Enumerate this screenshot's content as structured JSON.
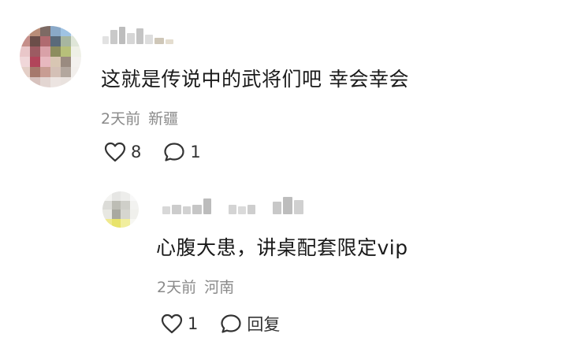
{
  "comments": [
    {
      "text": "这就是传说中的武将们吧 幸会幸会",
      "time": "2天前",
      "location": "新疆",
      "like_count": "8",
      "reply_count": "1",
      "avatar_pixels": [
        "#d9b9ae",
        "#b98d78",
        "#7d6a64",
        "#8aa9c8",
        "#9fc3e3",
        "#e6eef5",
        "#c58f8a",
        "#6b4e49",
        "#b06b70",
        "#5a6a7a",
        "#a7b6a0",
        "#dfe6d8",
        "#e9c7c9",
        "#9c5b62",
        "#d9a1a8",
        "#8c8d5e",
        "#b7c07a",
        "#eef0e6",
        "#f0d7d9",
        "#b1455a",
        "#e7b8bf",
        "#d8c6b3",
        "#9a8b80",
        "#f3f1ee",
        "#e4cfc7",
        "#a6796c",
        "#c89d93",
        "#d4c0b6",
        "#b3a79e",
        "#f2efec",
        "#f4ecea",
        "#d7c2bd",
        "#e3d6d2",
        "#ece4e1",
        "#e9e2de",
        "#f7f5f3"
      ]
    },
    {
      "text": "心腹大患，讲桌配套限定vip",
      "time": "2天前",
      "location": "河南",
      "like_count": "1",
      "reply_label": "回复",
      "avatar_pixels": [
        "#f4f4f2",
        "#e6e6e4",
        "#ededeb",
        "#f8f8f8",
        "#dcdcd8",
        "#bdbdb5",
        "#cfcfc9",
        "#f2f2f0",
        "#e8e8e2",
        "#a9a9a0",
        "#d6d6cf",
        "#f0f0ec",
        "#efe98e",
        "#e8e36a",
        "#f1ee9e",
        "#f7f7f2"
      ]
    }
  ],
  "colors": {
    "text": "#1a1a1a",
    "meta": "#8a8a8a",
    "icon": "#333333",
    "background": "#ffffff"
  },
  "icons": {
    "like": "heart-outline-icon",
    "comment": "speech-bubble-icon"
  }
}
